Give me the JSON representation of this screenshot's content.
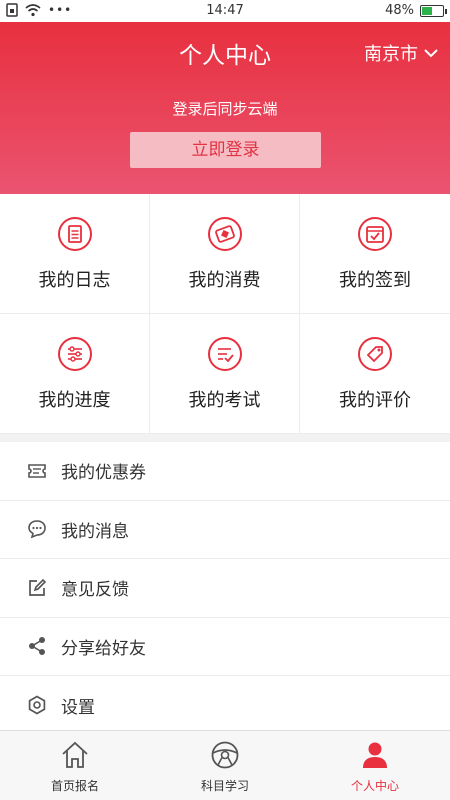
{
  "status_bar": {
    "time": "14:47",
    "battery": "48%",
    "battery_level": 0.48
  },
  "header": {
    "title": "个人中心",
    "city": "南京市",
    "login_hint": "登录后同步云端",
    "login_button": "立即登录"
  },
  "grid": [
    {
      "label": "我的日志",
      "icon": "log-icon"
    },
    {
      "label": "我的消费",
      "icon": "wallet-icon"
    },
    {
      "label": "我的签到",
      "icon": "calendar-check-icon"
    },
    {
      "label": "我的进度",
      "icon": "progress-icon"
    },
    {
      "label": "我的考试",
      "icon": "exam-icon"
    },
    {
      "label": "我的评价",
      "icon": "rating-tag-icon"
    }
  ],
  "list": [
    {
      "label": "我的优惠券",
      "icon": "coupon-icon"
    },
    {
      "label": "我的消息",
      "icon": "message-icon"
    },
    {
      "label": "意见反馈",
      "icon": "edit-icon"
    },
    {
      "label": "分享给好友",
      "icon": "share-icon"
    },
    {
      "label": "设置",
      "icon": "settings-icon"
    }
  ],
  "tabbar": [
    {
      "label": "首页报名",
      "icon": "home-icon"
    },
    {
      "label": "科目学习",
      "icon": "steering-wheel-icon"
    },
    {
      "label": "个人中心",
      "icon": "user-icon",
      "active": true
    }
  ],
  "colors": {
    "accent": "#e8303f",
    "accent_light": "#ea5470"
  }
}
